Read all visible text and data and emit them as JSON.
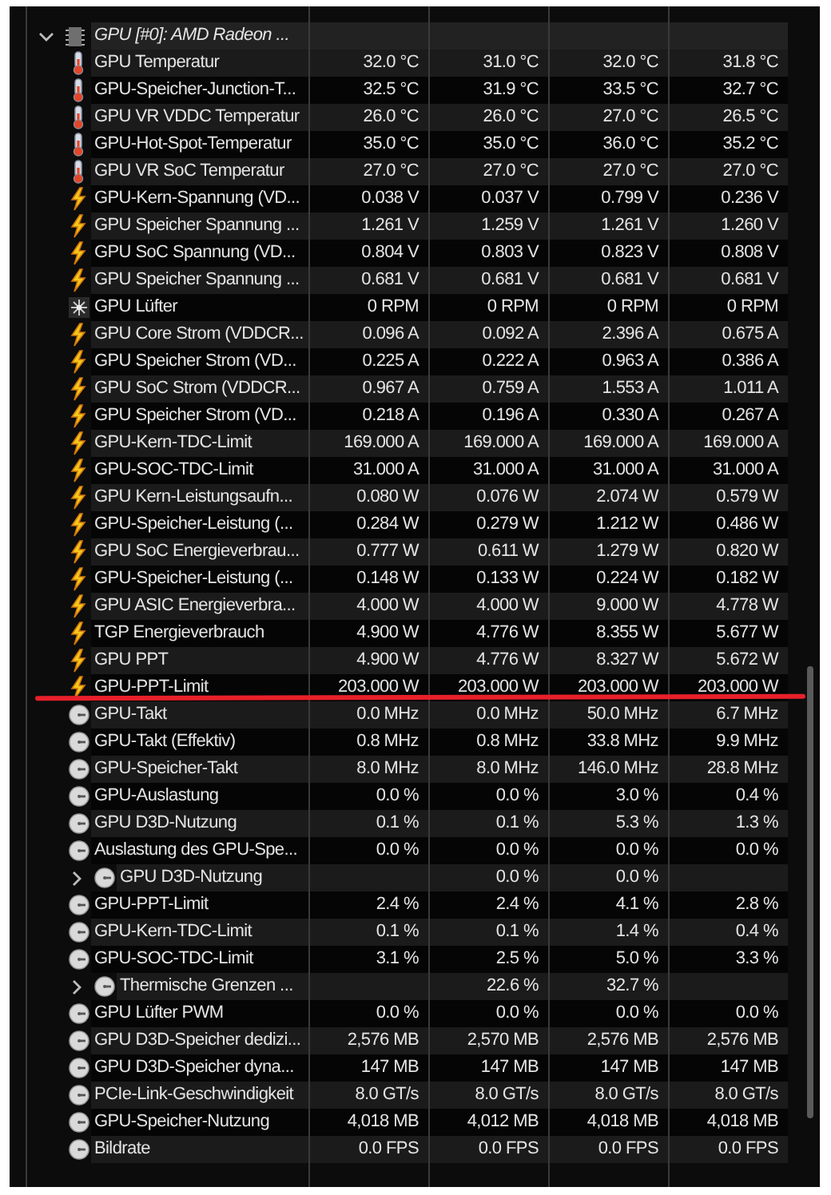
{
  "sensor_tree": {
    "label": "GPU [#0]: AMD Radeon ...",
    "expanded": true,
    "children": [
      {
        "kind": "temp",
        "label": "GPU Temperatur",
        "values": [
          "32.0 °C",
          "31.0 °C",
          "32.0 °C",
          "31.8 °C"
        ]
      },
      {
        "kind": "temp",
        "label": "GPU-Speicher-Junction-T...",
        "values": [
          "32.5 °C",
          "31.9 °C",
          "33.5 °C",
          "32.7 °C"
        ]
      },
      {
        "kind": "temp",
        "label": "GPU VR VDDC Temperatur",
        "values": [
          "26.0 °C",
          "26.0 °C",
          "27.0 °C",
          "26.5 °C"
        ]
      },
      {
        "kind": "temp",
        "label": "GPU-Hot-Spot-Temperatur",
        "values": [
          "35.0 °C",
          "35.0 °C",
          "36.0 °C",
          "35.2 °C"
        ]
      },
      {
        "kind": "temp",
        "label": "GPU VR SoC Temperatur",
        "values": [
          "27.0 °C",
          "27.0 °C",
          "27.0 °C",
          "27.0 °C"
        ]
      },
      {
        "kind": "bolt",
        "label": "GPU-Kern-Spannung (VD...",
        "values": [
          "0.038 V",
          "0.037 V",
          "0.799 V",
          "0.236 V"
        ]
      },
      {
        "kind": "bolt",
        "label": "GPU Speicher Spannung ...",
        "values": [
          "1.261 V",
          "1.259 V",
          "1.261 V",
          "1.260 V"
        ]
      },
      {
        "kind": "bolt",
        "label": "GPU SoC Spannung (VD...",
        "values": [
          "0.804 V",
          "0.803 V",
          "0.823 V",
          "0.808 V"
        ]
      },
      {
        "kind": "bolt",
        "label": "GPU Speicher Spannung ...",
        "values": [
          "0.681 V",
          "0.681 V",
          "0.681 V",
          "0.681 V"
        ]
      },
      {
        "kind": "fan",
        "label": "GPU Lüfter",
        "values": [
          "0 RPM",
          "0 RPM",
          "0 RPM",
          "0 RPM"
        ]
      },
      {
        "kind": "bolt",
        "label": "GPU Core Strom (VDDCR...",
        "values": [
          "0.096 A",
          "0.092 A",
          "2.396 A",
          "0.675 A"
        ]
      },
      {
        "kind": "bolt",
        "label": "GPU Speicher Strom (VD...",
        "values": [
          "0.225 A",
          "0.222 A",
          "0.963 A",
          "0.386 A"
        ]
      },
      {
        "kind": "bolt",
        "label": "GPU SoC Strom (VDDCR...",
        "values": [
          "0.967 A",
          "0.759 A",
          "1.553 A",
          "1.011 A"
        ]
      },
      {
        "kind": "bolt",
        "label": "GPU Speicher Strom (VD...",
        "values": [
          "0.218 A",
          "0.196 A",
          "0.330 A",
          "0.267 A"
        ]
      },
      {
        "kind": "bolt",
        "label": "GPU-Kern-TDC-Limit",
        "values": [
          "169.000 A",
          "169.000 A",
          "169.000 A",
          "169.000 A"
        ]
      },
      {
        "kind": "bolt",
        "label": "GPU-SOC-TDC-Limit",
        "values": [
          "31.000 A",
          "31.000 A",
          "31.000 A",
          "31.000 A"
        ]
      },
      {
        "kind": "bolt",
        "label": "GPU Kern-Leistungsaufn...",
        "values": [
          "0.080 W",
          "0.076 W",
          "2.074 W",
          "0.579 W"
        ]
      },
      {
        "kind": "bolt",
        "label": "GPU-Speicher-Leistung (...",
        "values": [
          "0.284 W",
          "0.279 W",
          "1.212 W",
          "0.486 W"
        ]
      },
      {
        "kind": "bolt",
        "label": "GPU SoC Energieverbrau...",
        "values": [
          "0.777 W",
          "0.611 W",
          "1.279 W",
          "0.820 W"
        ]
      },
      {
        "kind": "bolt",
        "label": "GPU-Speicher-Leistung (...",
        "values": [
          "0.148 W",
          "0.133 W",
          "0.224 W",
          "0.182 W"
        ]
      },
      {
        "kind": "bolt",
        "label": "GPU ASIC Energieverbra...",
        "values": [
          "4.000 W",
          "4.000 W",
          "9.000 W",
          "4.778 W"
        ]
      },
      {
        "kind": "bolt",
        "label": "TGP Energieverbrauch",
        "values": [
          "4.900 W",
          "4.776 W",
          "8.355 W",
          "5.677 W"
        ]
      },
      {
        "kind": "bolt",
        "label": "GPU PPT",
        "values": [
          "4.900 W",
          "4.776 W",
          "8.327 W",
          "5.672 W"
        ]
      },
      {
        "kind": "bolt",
        "label": "GPU-PPT-Limit",
        "values": [
          "203.000 W",
          "203.000 W",
          "203.000 W",
          "203.000 W"
        ]
      },
      {
        "kind": "gauge",
        "label": "GPU-Takt",
        "values": [
          "0.0 MHz",
          "0.0 MHz",
          "50.0 MHz",
          "6.7 MHz"
        ]
      },
      {
        "kind": "gauge",
        "label": "GPU-Takt (Effektiv)",
        "values": [
          "0.8 MHz",
          "0.8 MHz",
          "33.8 MHz",
          "9.9 MHz"
        ]
      },
      {
        "kind": "gauge",
        "label": "GPU-Speicher-Takt",
        "values": [
          "8.0 MHz",
          "8.0 MHz",
          "146.0 MHz",
          "28.8 MHz"
        ]
      },
      {
        "kind": "gauge",
        "label": "GPU-Auslastung",
        "values": [
          "0.0 %",
          "0.0 %",
          "3.0 %",
          "0.4 %"
        ]
      },
      {
        "kind": "gauge",
        "label": "GPU D3D-Nutzung",
        "values": [
          "0.1 %",
          "0.1 %",
          "5.3 %",
          "1.3 %"
        ]
      },
      {
        "kind": "gauge",
        "label": "Auslastung des GPU-Spe...",
        "values": [
          "0.0 %",
          "0.0 %",
          "0.0 %",
          "0.0 %"
        ]
      },
      {
        "kind": "gauge",
        "label": "GPU D3D-Nutzung",
        "expanded": false,
        "values": [
          "0.0 %",
          "0.0 %"
        ]
      },
      {
        "kind": "gauge",
        "label": "GPU-PPT-Limit",
        "values": [
          "2.4 %",
          "2.4 %",
          "4.1 %",
          "2.8 %"
        ]
      },
      {
        "kind": "gauge",
        "label": "GPU-Kern-TDC-Limit",
        "values": [
          "0.1 %",
          "0.1 %",
          "1.4 %",
          "0.4 %"
        ]
      },
      {
        "kind": "gauge",
        "label": "GPU-SOC-TDC-Limit",
        "values": [
          "3.1 %",
          "2.5 %",
          "5.0 %",
          "3.3 %"
        ]
      },
      {
        "kind": "gauge",
        "label": "Thermische Grenzen ...",
        "expanded": false,
        "values": [
          "22.6 %",
          "32.7 %"
        ]
      },
      {
        "kind": "gauge",
        "label": "GPU Lüfter PWM",
        "values": [
          "0.0 %",
          "0.0 %",
          "0.0 %",
          "0.0 %"
        ]
      },
      {
        "kind": "gauge",
        "label": "GPU D3D-Speicher dedizi...",
        "values": [
          "2,576 MB",
          "2,570 MB",
          "2,576 MB",
          "2,576 MB"
        ]
      },
      {
        "kind": "gauge",
        "label": "GPU D3D-Speicher dyna...",
        "values": [
          "147 MB",
          "147 MB",
          "147 MB",
          "147 MB"
        ]
      },
      {
        "kind": "gauge",
        "label": "PCIe-Link-Geschwindigkeit",
        "values": [
          "8.0 GT/s",
          "8.0 GT/s",
          "8.0 GT/s",
          "8.0 GT/s"
        ]
      },
      {
        "kind": "gauge",
        "label": "GPU-Speicher-Nutzung",
        "values": [
          "4,018 MB",
          "4,012 MB",
          "4,018 MB",
          "4,018 MB"
        ]
      },
      {
        "kind": "gauge",
        "label": "Bildrate",
        "values": [
          "0.0 FPS",
          "0.0 FPS",
          "0.0 FPS",
          "0.0 FPS"
        ]
      }
    ]
  }
}
